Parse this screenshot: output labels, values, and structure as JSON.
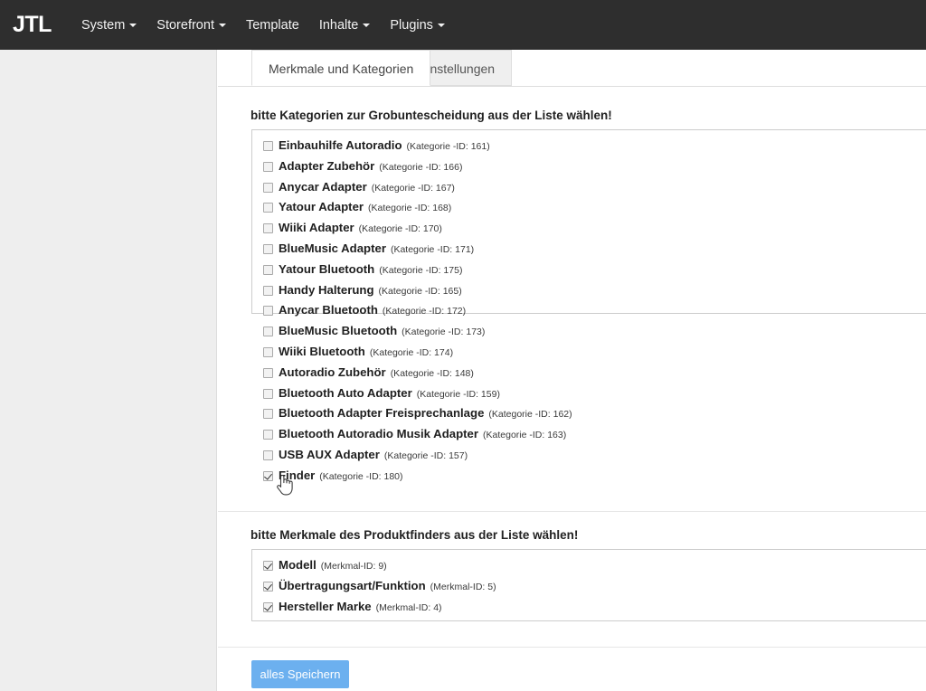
{
  "navbar": {
    "brand": "JTL",
    "items": [
      {
        "label": "System",
        "has_caret": true
      },
      {
        "label": "Storefront",
        "has_caret": true
      },
      {
        "label": "Template",
        "has_caret": false
      },
      {
        "label": "Inhalte",
        "has_caret": true
      },
      {
        "label": "Plugins",
        "has_caret": true
      }
    ]
  },
  "tabs": [
    {
      "label": "Merkmale und Kategorien",
      "active": true
    },
    {
      "label": "Einstellungen",
      "active": false
    }
  ],
  "sections": {
    "categories": {
      "heading": "bitte Kategorien zur Grobuntescheidung aus der Liste wählen!",
      "items": [
        {
          "label": "Einbauhilfe Autoradio",
          "id_text": "(Kategorie -ID: 161)",
          "checked": false
        },
        {
          "label": "Adapter Zubehör",
          "id_text": "(Kategorie -ID: 166)",
          "checked": false
        },
        {
          "label": "Anycar Adapter",
          "id_text": "(Kategorie -ID: 167)",
          "checked": false
        },
        {
          "label": "Yatour Adapter",
          "id_text": "(Kategorie -ID: 168)",
          "checked": false
        },
        {
          "label": "Wiiki Adapter",
          "id_text": "(Kategorie -ID: 170)",
          "checked": false
        },
        {
          "label": "BlueMusic Adapter",
          "id_text": "(Kategorie -ID: 171)",
          "checked": false
        },
        {
          "label": "Yatour Bluetooth",
          "id_text": "(Kategorie -ID: 175)",
          "checked": false
        },
        {
          "label": "Handy Halterung",
          "id_text": "(Kategorie -ID: 165)",
          "checked": false
        },
        {
          "label": "Anycar Bluetooth",
          "id_text": "(Kategorie -ID: 172)",
          "checked": false
        },
        {
          "label": "BlueMusic Bluetooth",
          "id_text": "(Kategorie -ID: 173)",
          "checked": false
        },
        {
          "label": "Wiiki Bluetooth",
          "id_text": "(Kategorie -ID: 174)",
          "checked": false
        },
        {
          "label": "Autoradio Zubehör",
          "id_text": "(Kategorie -ID: 148)",
          "checked": false
        },
        {
          "label": "Bluetooth Auto Adapter",
          "id_text": "(Kategorie -ID: 159)",
          "checked": false
        },
        {
          "label": "Bluetooth Adapter Freisprechanlage",
          "id_text": "(Kategorie -ID: 162)",
          "checked": false
        },
        {
          "label": "Bluetooth Autoradio Musik Adapter",
          "id_text": "(Kategorie -ID: 163)",
          "checked": false
        },
        {
          "label": "USB AUX Adapter",
          "id_text": "(Kategorie -ID: 157)",
          "checked": false
        },
        {
          "label": "Finder",
          "id_text": "(Kategorie -ID: 180)",
          "checked": true
        }
      ]
    },
    "merkmale": {
      "heading": "bitte Merkmale des Produktfinders aus der Liste wählen!",
      "items": [
        {
          "label": "Modell",
          "id_text": "(Merkmal-ID: 9)",
          "checked": true
        },
        {
          "label": "Übertragungsart/Funktion",
          "id_text": "(Merkmal-ID: 5)",
          "checked": true
        },
        {
          "label": "Hersteller Marke",
          "id_text": "(Merkmal-ID: 4)",
          "checked": true
        }
      ]
    }
  },
  "footer": {
    "save_label": "alles Speichern"
  },
  "colors": {
    "navbar_bg": "#2e2e2e",
    "sidebar_bg": "#eeeeee",
    "button_primary": "#6cb0ef",
    "panel_border": "#cccccc"
  }
}
